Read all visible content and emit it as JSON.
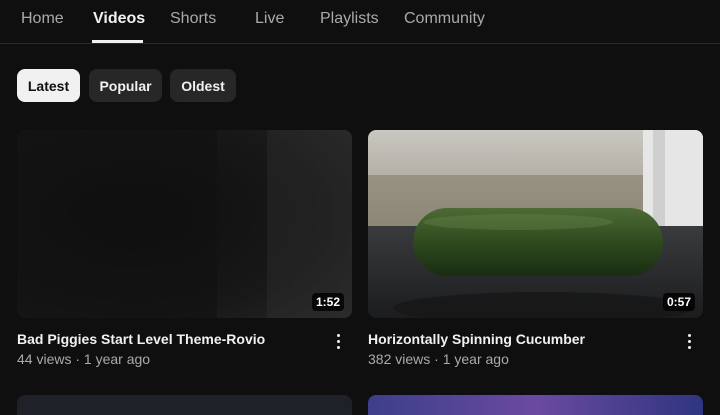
{
  "tabs": [
    {
      "label": "Home"
    },
    {
      "label": "Videos"
    },
    {
      "label": "Shorts"
    },
    {
      "label": "Live"
    },
    {
      "label": "Playlists"
    },
    {
      "label": "Community"
    }
  ],
  "active_tab": "Videos",
  "filters": [
    {
      "label": "Latest",
      "selected": true
    },
    {
      "label": "Popular",
      "selected": false
    },
    {
      "label": "Oldest",
      "selected": false
    }
  ],
  "videos": [
    {
      "title": "Bad Piggies Start Level Theme-Rovio",
      "meta": "44 views · 1 year ago",
      "duration": "1:52"
    },
    {
      "title": "Horizontally Spinning Cucumber",
      "meta": "382 views · 1 year ago",
      "duration": "0:57"
    }
  ],
  "icons": {
    "more": "more-vert-icon"
  }
}
